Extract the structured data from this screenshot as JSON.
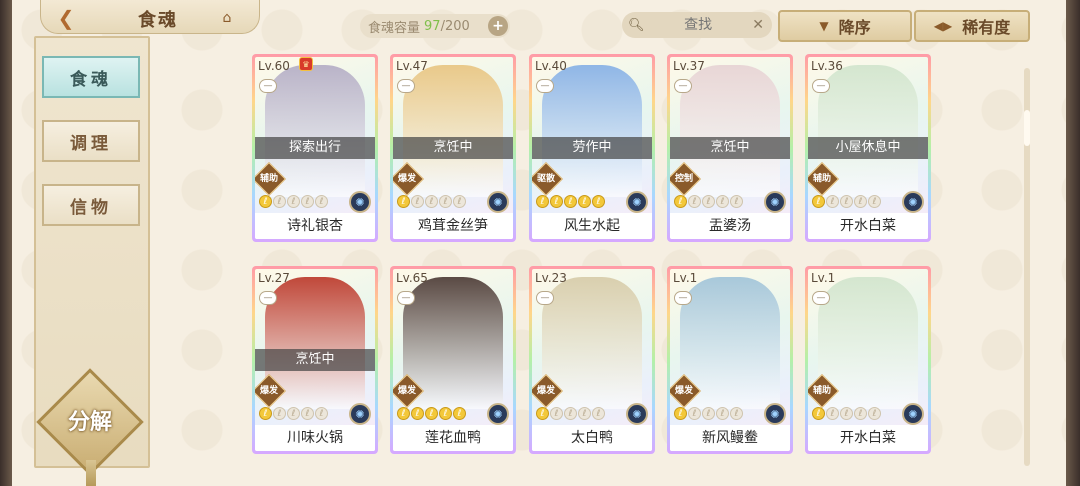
{
  "header": {
    "back_icon": "back-arrow-icon",
    "title": "食魂",
    "home_icon": "home-icon",
    "capacity_label": "食魂容量",
    "capacity_current": "97",
    "capacity_max": "/200",
    "capacity_add_icon": "plus-icon",
    "search_placeholder": "查找",
    "search_icon": "search-icon",
    "clear_icon": "close-icon",
    "sort_order_label": "降序",
    "sort_key_label": "稀有度"
  },
  "sidebar": {
    "items": [
      {
        "label": "食魂",
        "active": true
      },
      {
        "label": "调理",
        "active": false
      },
      {
        "label": "信物",
        "active": false
      }
    ],
    "decompose_label": "分解"
  },
  "cards": [
    {
      "level": "Lv.60",
      "status": "探索出行",
      "role": "辅助",
      "stars": 1,
      "name": "诗礼银杏",
      "crown": true,
      "color": "#b9b3c8"
    },
    {
      "level": "Lv.47",
      "status": "烹饪中",
      "role": "爆发",
      "stars": 1,
      "name": "鸡茸金丝笋",
      "crown": false,
      "color": "#e9c98a"
    },
    {
      "level": "Lv.40",
      "status": "劳作中",
      "role": "驱散",
      "stars": 5,
      "name": "风生水起",
      "crown": false,
      "color": "#8fb6e6"
    },
    {
      "level": "Lv.37",
      "status": "烹饪中",
      "role": "控制",
      "stars": 1,
      "name": "盂婆汤",
      "crown": false,
      "color": "#e8d6d6"
    },
    {
      "level": "Lv.36",
      "status": "小屋休息中",
      "role": "辅助",
      "stars": 1,
      "name": "开水白菜",
      "crown": false,
      "color": "#d4e6cf"
    },
    {
      "level": "Lv.27",
      "status": "烹饪中",
      "role": "爆发",
      "stars": 1,
      "name": "川味火锅",
      "crown": false,
      "color": "#c0483a"
    },
    {
      "level": "Lv.65",
      "status": "",
      "role": "爆发",
      "stars": 5,
      "name": "莲花血鸭",
      "crown": false,
      "color": "#5a4a44"
    },
    {
      "level": "Lv.23",
      "status": "",
      "role": "爆发",
      "stars": 1,
      "name": "太白鸭",
      "crown": false,
      "color": "#d9cfae"
    },
    {
      "level": "Lv.1",
      "status": "",
      "role": "爆发",
      "stars": 1,
      "name": "新风鳗鲞",
      "crown": false,
      "color": "#a8c8da"
    },
    {
      "level": "Lv.1",
      "status": "",
      "role": "辅助",
      "stars": 1,
      "name": "开水白菜",
      "crown": false,
      "color": "#d4e6cf"
    }
  ]
}
